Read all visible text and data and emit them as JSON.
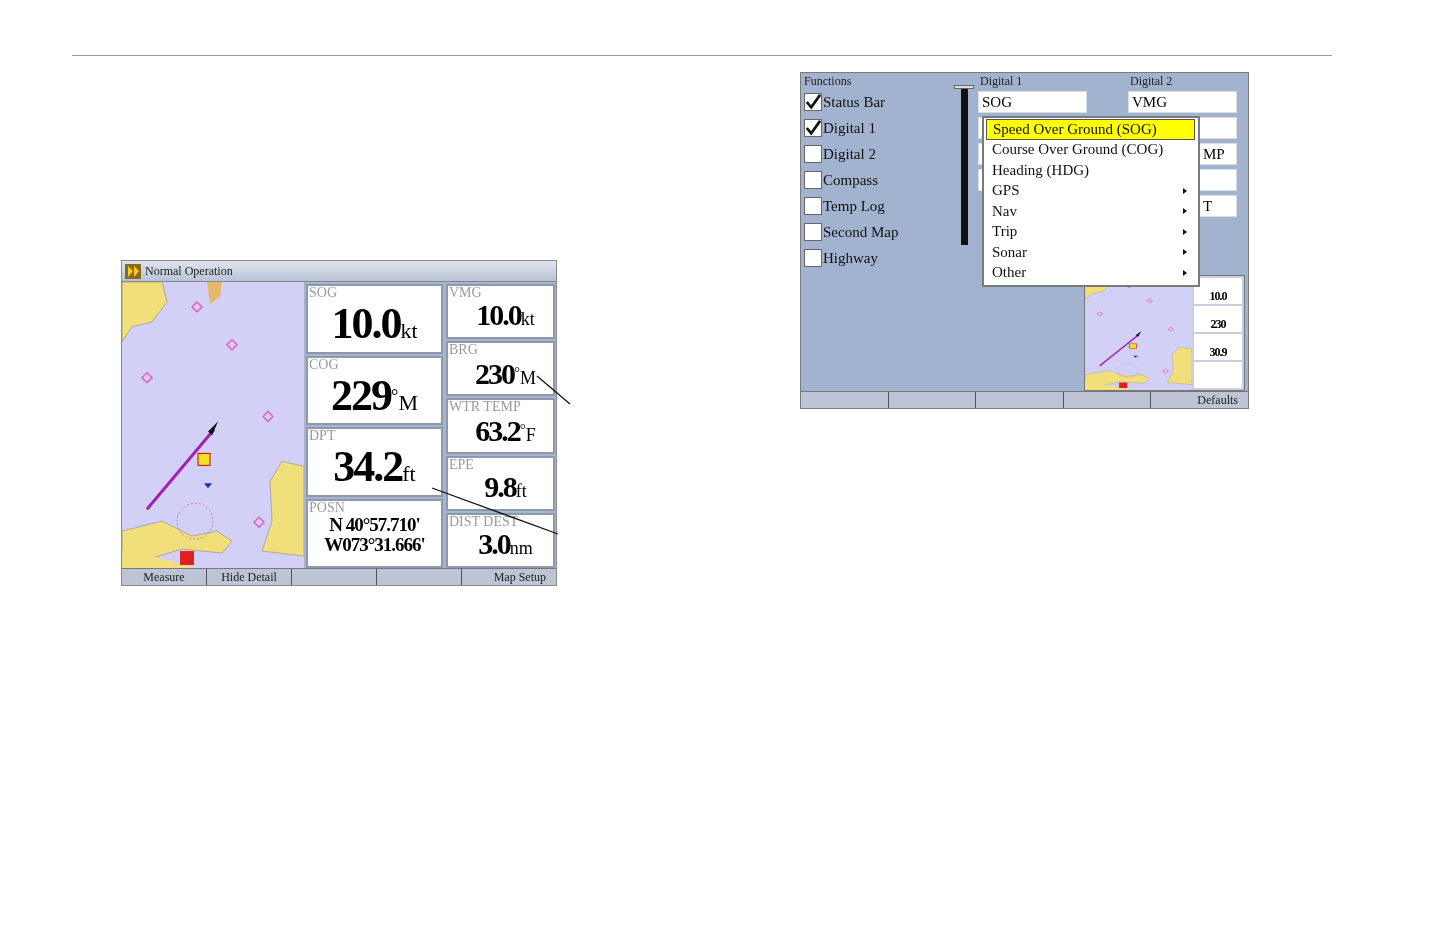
{
  "left_screen": {
    "title": "Normal Operation",
    "map": {
      "kind": "picture"
    },
    "columns": [
      [
        {
          "kind": "reading",
          "label": "SOG",
          "value": "10.0",
          "unit": "kt"
        },
        {
          "kind": "reading",
          "label": "COG",
          "value": "229",
          "unit": "$^{°}$M"
        },
        {
          "kind": "reading",
          "label": "DPT",
          "value": "34.2",
          "unit": "ft"
        },
        {
          "kind": "position",
          "label": "POSN",
          "lines": [
            "N  40°57.710'",
            "W073°31.666'"
          ]
        }
      ],
      [
        {
          "kind": "reading",
          "label": "VMG",
          "value": "10.0",
          "unit": "kt"
        },
        {
          "kind": "reading",
          "label": "BRG",
          "value": "230",
          "unit": "$^{°}$M"
        },
        {
          "kind": "reading",
          "label": "WTR TEMP",
          "value": "63.2",
          "unit": "$^{°}$F"
        },
        {
          "kind": "reading",
          "label": "EPE",
          "value": "9.8",
          "unit": "ft"
        },
        {
          "kind": "reading",
          "label": "DIST DEST",
          "value": "3.0",
          "unit": "nm"
        }
      ]
    ],
    "softkeys": [
      {
        "kind": "label",
        "label": "Measure"
      },
      {
        "kind": "label",
        "label": "Hide Detail"
      },
      {
        "kind": "blank"
      },
      {
        "kind": "blank"
      },
      {
        "kind": "label",
        "label": "Map Setup"
      }
    ]
  },
  "right_screen": {
    "headers": [
      "Functions",
      "Digital 1",
      "Digital 2"
    ],
    "functions": [
      {
        "label": "Status Bar",
        "checked": true
      },
      {
        "label": "Digital 1",
        "checked": true
      },
      {
        "label": "Digital 2",
        "checked": false
      },
      {
        "label": "Compass",
        "checked": false
      },
      {
        "label": "Temp Log",
        "checked": false
      },
      {
        "label": "Second Map",
        "checked": false
      },
      {
        "label": "Highway",
        "checked": false
      }
    ],
    "digital_1": [
      {
        "kind": "value",
        "value": "SOG"
      },
      {
        "kind": "blank"
      },
      {
        "kind": "blank"
      },
      {
        "kind": "blank"
      }
    ],
    "digital_2": [
      {
        "kind": "value",
        "value": "VMG"
      },
      {
        "kind": "blank"
      },
      {
        "kind": "value",
        "value": "MP"
      },
      {
        "kind": "blank"
      },
      {
        "kind": "value",
        "value": "T"
      }
    ],
    "menu": [
      {
        "label": "Speed Over Ground (SOG)",
        "selected": true,
        "submenu": false
      },
      {
        "label": "Course Over Ground (COG)",
        "selected": false,
        "submenu": false
      },
      {
        "label": "Heading (HDG)",
        "selected": false,
        "submenu": false
      },
      {
        "label": "GPS",
        "selected": false,
        "submenu": true
      },
      {
        "label": "Nav",
        "selected": false,
        "submenu": true
      },
      {
        "label": "Trip",
        "selected": false,
        "submenu": true
      },
      {
        "label": "Sonar",
        "selected": false,
        "submenu": true
      },
      {
        "label": "Other",
        "selected": false,
        "submenu": true
      }
    ],
    "preview": {
      "map": {
        "kind": "picture"
      },
      "values": [
        "10.0",
        "230",
        "30.9"
      ]
    },
    "softkeys": [
      {
        "kind": "blank"
      },
      {
        "kind": "blank"
      },
      {
        "kind": "blank"
      },
      {
        "kind": "blank"
      },
      {
        "kind": "label",
        "label": "Defaults"
      }
    ]
  }
}
